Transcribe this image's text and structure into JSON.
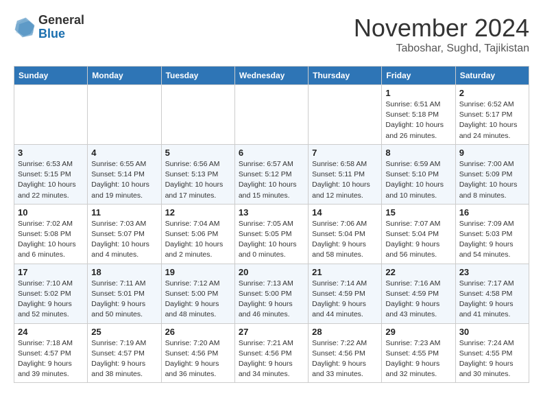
{
  "header": {
    "logo_general": "General",
    "logo_blue": "Blue",
    "month_title": "November 2024",
    "subtitle": "Taboshar, Sughd, Tajikistan"
  },
  "days_of_week": [
    "Sunday",
    "Monday",
    "Tuesday",
    "Wednesday",
    "Thursday",
    "Friday",
    "Saturday"
  ],
  "weeks": [
    [
      {
        "day": "",
        "info": ""
      },
      {
        "day": "",
        "info": ""
      },
      {
        "day": "",
        "info": ""
      },
      {
        "day": "",
        "info": ""
      },
      {
        "day": "",
        "info": ""
      },
      {
        "day": "1",
        "info": "Sunrise: 6:51 AM\nSunset: 5:18 PM\nDaylight: 10 hours and 26 minutes."
      },
      {
        "day": "2",
        "info": "Sunrise: 6:52 AM\nSunset: 5:17 PM\nDaylight: 10 hours and 24 minutes."
      }
    ],
    [
      {
        "day": "3",
        "info": "Sunrise: 6:53 AM\nSunset: 5:15 PM\nDaylight: 10 hours and 22 minutes."
      },
      {
        "day": "4",
        "info": "Sunrise: 6:55 AM\nSunset: 5:14 PM\nDaylight: 10 hours and 19 minutes."
      },
      {
        "day": "5",
        "info": "Sunrise: 6:56 AM\nSunset: 5:13 PM\nDaylight: 10 hours and 17 minutes."
      },
      {
        "day": "6",
        "info": "Sunrise: 6:57 AM\nSunset: 5:12 PM\nDaylight: 10 hours and 15 minutes."
      },
      {
        "day": "7",
        "info": "Sunrise: 6:58 AM\nSunset: 5:11 PM\nDaylight: 10 hours and 12 minutes."
      },
      {
        "day": "8",
        "info": "Sunrise: 6:59 AM\nSunset: 5:10 PM\nDaylight: 10 hours and 10 minutes."
      },
      {
        "day": "9",
        "info": "Sunrise: 7:00 AM\nSunset: 5:09 PM\nDaylight: 10 hours and 8 minutes."
      }
    ],
    [
      {
        "day": "10",
        "info": "Sunrise: 7:02 AM\nSunset: 5:08 PM\nDaylight: 10 hours and 6 minutes."
      },
      {
        "day": "11",
        "info": "Sunrise: 7:03 AM\nSunset: 5:07 PM\nDaylight: 10 hours and 4 minutes."
      },
      {
        "day": "12",
        "info": "Sunrise: 7:04 AM\nSunset: 5:06 PM\nDaylight: 10 hours and 2 minutes."
      },
      {
        "day": "13",
        "info": "Sunrise: 7:05 AM\nSunset: 5:05 PM\nDaylight: 10 hours and 0 minutes."
      },
      {
        "day": "14",
        "info": "Sunrise: 7:06 AM\nSunset: 5:04 PM\nDaylight: 9 hours and 58 minutes."
      },
      {
        "day": "15",
        "info": "Sunrise: 7:07 AM\nSunset: 5:04 PM\nDaylight: 9 hours and 56 minutes."
      },
      {
        "day": "16",
        "info": "Sunrise: 7:09 AM\nSunset: 5:03 PM\nDaylight: 9 hours and 54 minutes."
      }
    ],
    [
      {
        "day": "17",
        "info": "Sunrise: 7:10 AM\nSunset: 5:02 PM\nDaylight: 9 hours and 52 minutes."
      },
      {
        "day": "18",
        "info": "Sunrise: 7:11 AM\nSunset: 5:01 PM\nDaylight: 9 hours and 50 minutes."
      },
      {
        "day": "19",
        "info": "Sunrise: 7:12 AM\nSunset: 5:00 PM\nDaylight: 9 hours and 48 minutes."
      },
      {
        "day": "20",
        "info": "Sunrise: 7:13 AM\nSunset: 5:00 PM\nDaylight: 9 hours and 46 minutes."
      },
      {
        "day": "21",
        "info": "Sunrise: 7:14 AM\nSunset: 4:59 PM\nDaylight: 9 hours and 44 minutes."
      },
      {
        "day": "22",
        "info": "Sunrise: 7:16 AM\nSunset: 4:59 PM\nDaylight: 9 hours and 43 minutes."
      },
      {
        "day": "23",
        "info": "Sunrise: 7:17 AM\nSunset: 4:58 PM\nDaylight: 9 hours and 41 minutes."
      }
    ],
    [
      {
        "day": "24",
        "info": "Sunrise: 7:18 AM\nSunset: 4:57 PM\nDaylight: 9 hours and 39 minutes."
      },
      {
        "day": "25",
        "info": "Sunrise: 7:19 AM\nSunset: 4:57 PM\nDaylight: 9 hours and 38 minutes."
      },
      {
        "day": "26",
        "info": "Sunrise: 7:20 AM\nSunset: 4:56 PM\nDaylight: 9 hours and 36 minutes."
      },
      {
        "day": "27",
        "info": "Sunrise: 7:21 AM\nSunset: 4:56 PM\nDaylight: 9 hours and 34 minutes."
      },
      {
        "day": "28",
        "info": "Sunrise: 7:22 AM\nSunset: 4:56 PM\nDaylight: 9 hours and 33 minutes."
      },
      {
        "day": "29",
        "info": "Sunrise: 7:23 AM\nSunset: 4:55 PM\nDaylight: 9 hours and 32 minutes."
      },
      {
        "day": "30",
        "info": "Sunrise: 7:24 AM\nSunset: 4:55 PM\nDaylight: 9 hours and 30 minutes."
      }
    ]
  ]
}
